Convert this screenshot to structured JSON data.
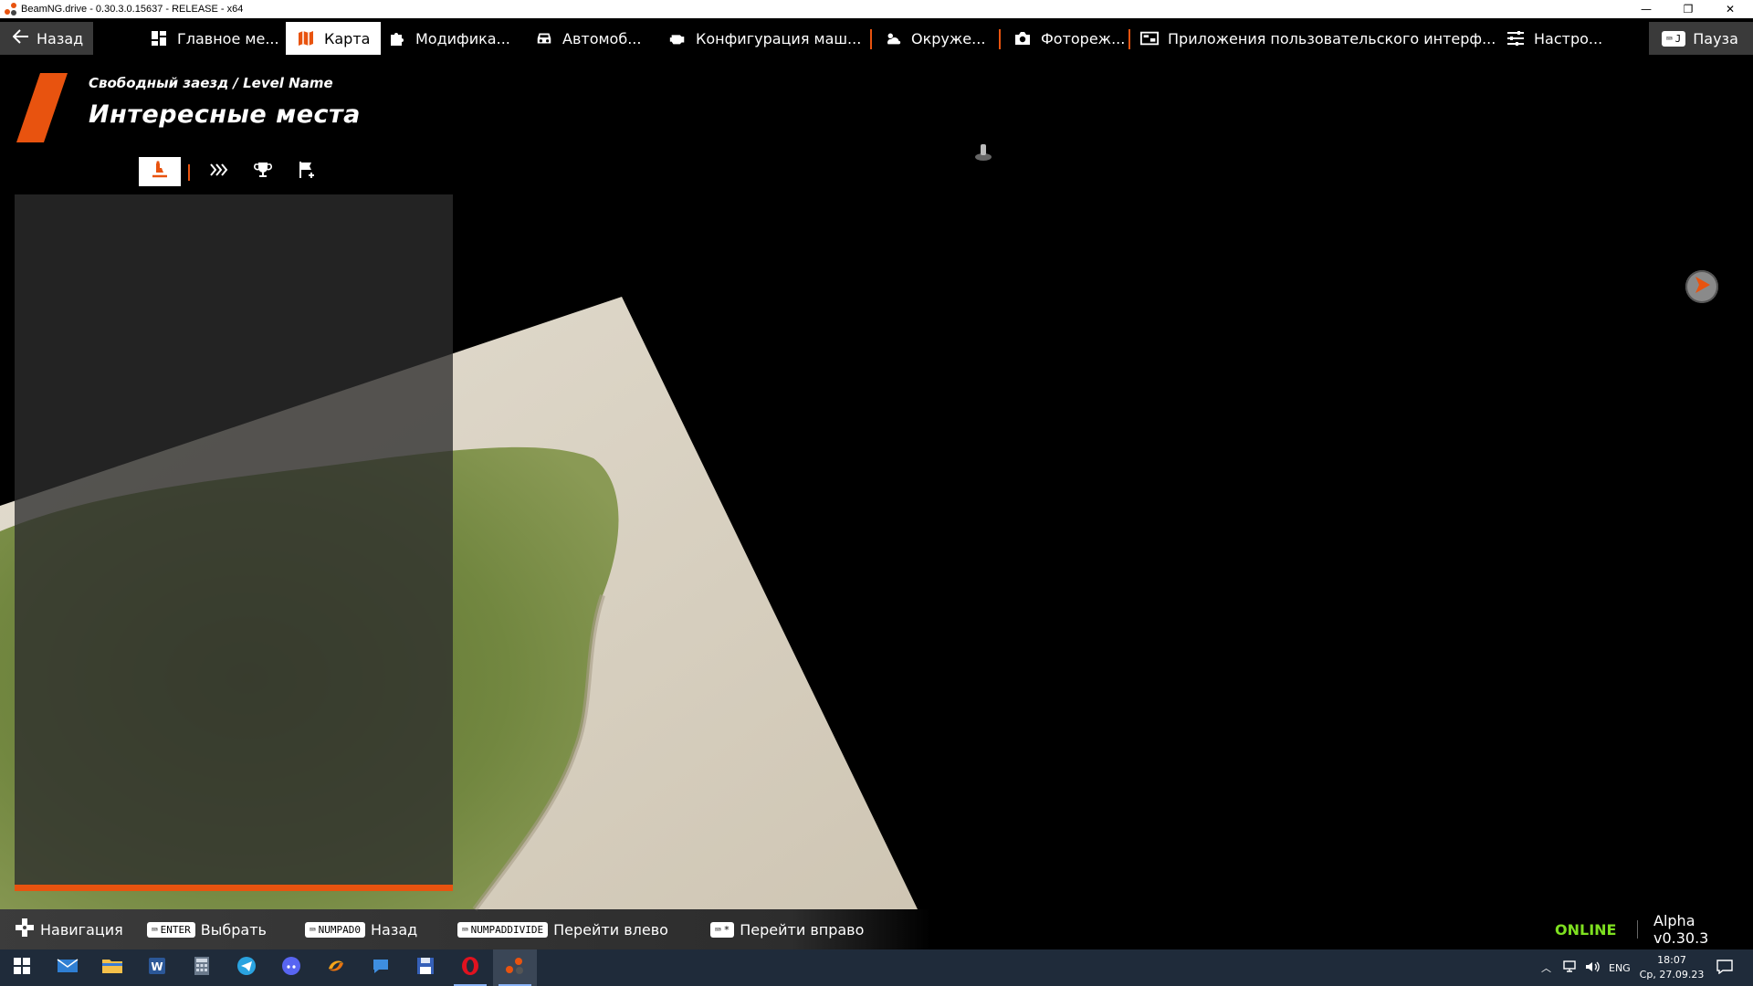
{
  "window": {
    "title": "BeamNG.drive - 0.30.3.0.15637 - RELEASE - x64",
    "controls": [
      "—",
      "❐",
      "✕"
    ]
  },
  "topmenu": {
    "back_label": "Назад",
    "items": [
      {
        "label": "Главное ме...",
        "icon": "dashboard-icon"
      },
      {
        "label": "Карта",
        "icon": "map-icon",
        "active": true
      },
      {
        "label": "Модифика...",
        "icon": "puzzle-icon"
      },
      {
        "label": "Автомоб...",
        "icon": "car-icon"
      },
      {
        "label": "Конфигурация маш...",
        "icon": "engine-icon"
      },
      {
        "label": "Окруже...",
        "icon": "weather-icon"
      },
      {
        "label": "Фотореж...",
        "icon": "camera-icon"
      },
      {
        "label": "Приложения пользовательского интерф...",
        "icon": "ui-apps-icon"
      },
      {
        "label": "Настро...",
        "icon": "sliders-icon"
      }
    ],
    "pause": {
      "key": "J",
      "label": "Пауза"
    }
  },
  "header": {
    "breadcrumb": "Свободный заезд / Level Name",
    "title": "Интересные места"
  },
  "filters": [
    {
      "icon": "spawn-point-icon",
      "active": true
    },
    {
      "icon": "chevrons-right-icon"
    },
    {
      "icon": "trophy-icon"
    },
    {
      "icon": "flag-add-icon"
    }
  ],
  "hints": [
    {
      "icon": "dpad-icon",
      "label": "Навигация"
    },
    {
      "key": "ENTER",
      "label": "Выбрать"
    },
    {
      "key": "NUMPAD0",
      "label": "Назад"
    },
    {
      "key": "NUMPADDIVIDE",
      "label": "Перейти влево"
    },
    {
      "key": "*",
      "label": "Перейти вправо"
    }
  ],
  "status": {
    "online": "ONLINE",
    "version": "Alpha v0.30.3"
  },
  "taskbar": {
    "lang": "ENG",
    "time": "18:07",
    "date": "Ср, 27.09.23"
  },
  "colors": {
    "accent": "#e8530f",
    "online": "#7ee020",
    "panel": "#2d2d2d",
    "terrain_sand": "#d9d2c3",
    "terrain_grass": "#6d7f3a"
  }
}
